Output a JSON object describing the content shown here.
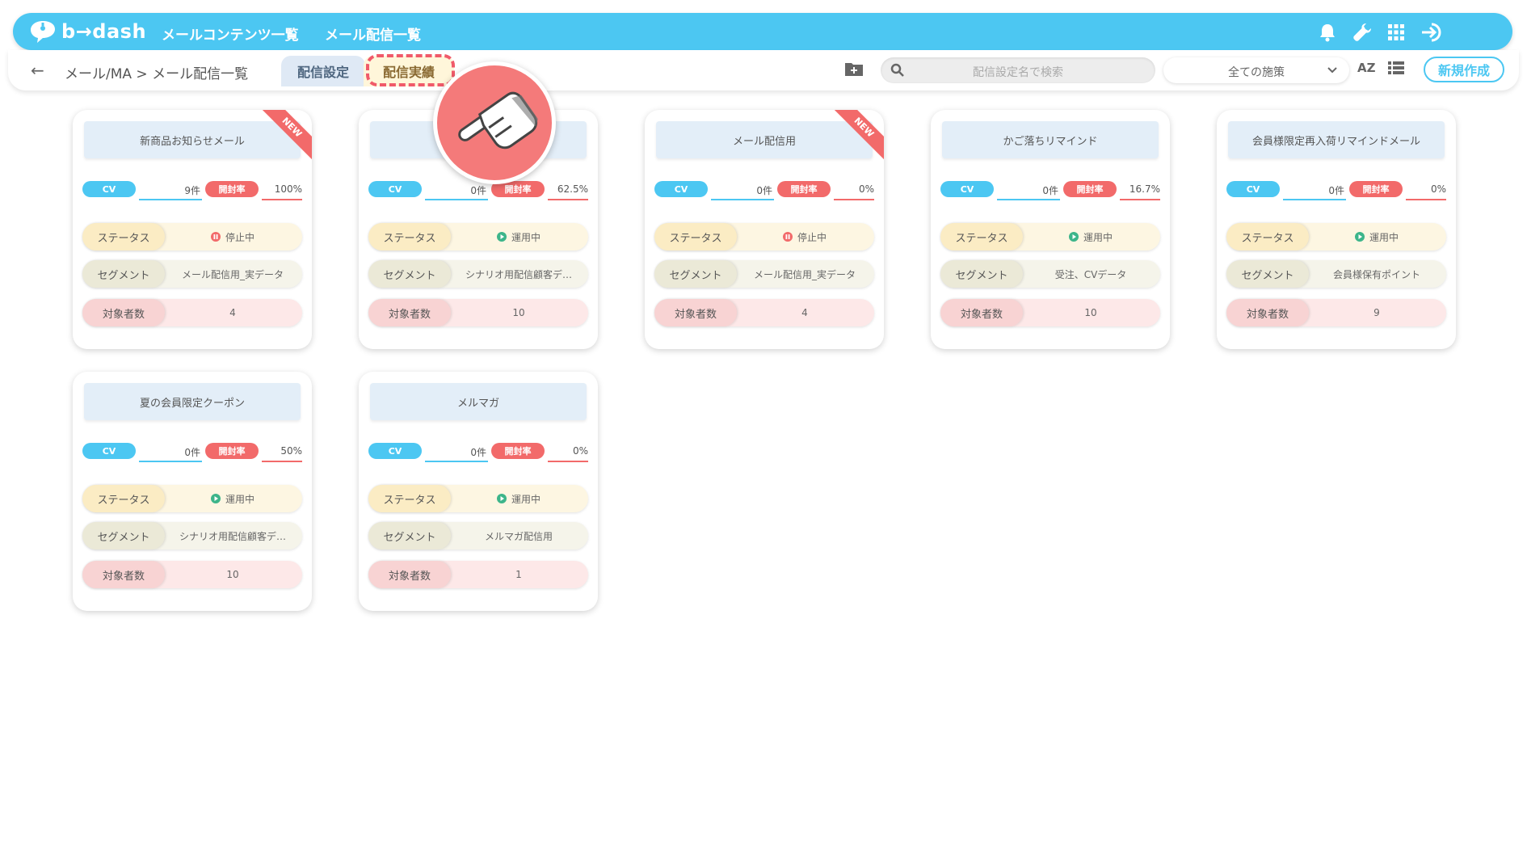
{
  "app": {
    "logo_text": "b→dash",
    "nav": [
      "メールコンテンツ一覧",
      "メール配信一覧"
    ]
  },
  "subbar": {
    "breadcrumb": "メール/MA  >  メール配信一覧",
    "tabs": [
      "配信設定",
      "配信実績"
    ],
    "search_placeholder": "配信設定名で検索",
    "select_value": "全ての施策",
    "sort_label": "AZ",
    "new_button": "新規作成"
  },
  "labels": {
    "cv": "CV",
    "open_rate": "開封率",
    "status": "ステータス",
    "segment": "セグメント",
    "target": "対象者数",
    "new_badge": "NEW"
  },
  "colors": {
    "primary": "#4cc7f2",
    "accent_red": "#f26a6a",
    "running": "#3db58a"
  },
  "cards": [
    {
      "title": "新商品お知らせメール",
      "is_new": true,
      "cv": "9件",
      "open_rate": "100%",
      "status": "停止中",
      "status_type": "stopped",
      "segment": "メール配信用_実データ",
      "target": "4"
    },
    {
      "title": "",
      "is_new": false,
      "cv": "0件",
      "open_rate": "62.5%",
      "status": "運用中",
      "status_type": "running",
      "segment": "シナリオ用配信顧客デ…",
      "target": "10"
    },
    {
      "title": "メール配信用",
      "is_new": true,
      "cv": "0件",
      "open_rate": "0%",
      "status": "停止中",
      "status_type": "stopped",
      "segment": "メール配信用_実データ",
      "target": "4"
    },
    {
      "title": "かご落ちリマインド",
      "is_new": false,
      "cv": "0件",
      "open_rate": "16.7%",
      "status": "運用中",
      "status_type": "running",
      "segment": "受注、CVデータ",
      "target": "10"
    },
    {
      "title": "会員様限定再入荷リマインドメール",
      "is_new": false,
      "cv": "0件",
      "open_rate": "0%",
      "status": "運用中",
      "status_type": "running",
      "segment": "会員様保有ポイント",
      "target": "9"
    },
    {
      "title": "夏の会員限定クーポン",
      "is_new": false,
      "cv": "0件",
      "open_rate": "50%",
      "status": "運用中",
      "status_type": "running",
      "segment": "シナリオ用配信顧客デ…",
      "target": "10"
    },
    {
      "title": "メルマガ",
      "is_new": false,
      "cv": "0件",
      "open_rate": "0%",
      "status": "運用中",
      "status_type": "running",
      "segment": "メルマガ配信用",
      "target": "1"
    }
  ]
}
